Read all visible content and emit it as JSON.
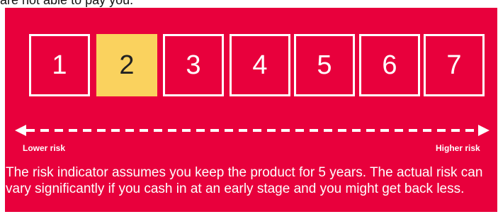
{
  "top_text": "are not able to pay you.",
  "scale": {
    "numbers": [
      "1",
      "2",
      "3",
      "4",
      "5",
      "6",
      "7"
    ],
    "selected": "2"
  },
  "labels": {
    "lower": "Lower risk",
    "higher": "Higher risk"
  },
  "note": "The risk indicator assumes you keep the product for 5 years. The actual risk can vary significantly if you cash in at an early stage and you might get back less.",
  "colors": {
    "panel_bg": "#E8003C",
    "highlight": "#FAD25E",
    "text": "#ffffff"
  },
  "icons": {
    "arrow": "double-headed-dashed-arrow"
  }
}
